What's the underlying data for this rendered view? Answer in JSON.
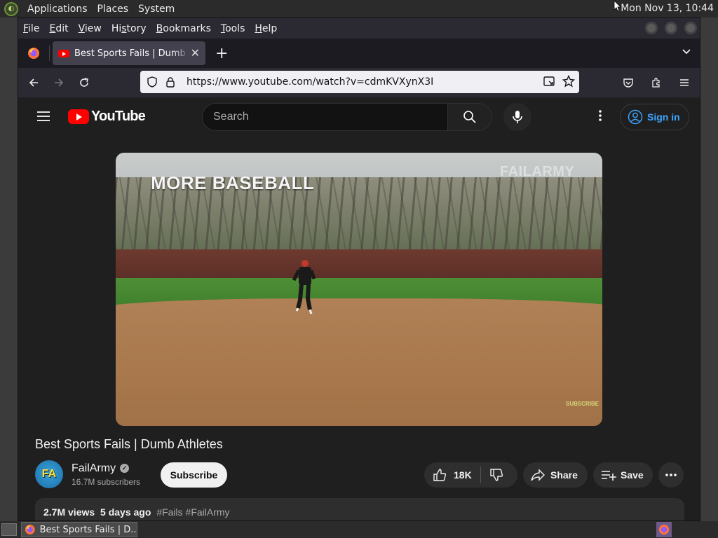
{
  "panel": {
    "menus": [
      "Applications",
      "Places",
      "System"
    ],
    "clock": "Mon Nov 13, 10:44"
  },
  "firefox": {
    "menus": [
      {
        "pre": "",
        "u": "F",
        "post": "ile"
      },
      {
        "pre": "",
        "u": "E",
        "post": "dit"
      },
      {
        "pre": "",
        "u": "V",
        "post": "iew"
      },
      {
        "pre": "Hi",
        "u": "s",
        "post": "tory"
      },
      {
        "pre": "",
        "u": "B",
        "post": "ookmarks"
      },
      {
        "pre": "",
        "u": "T",
        "post": "ools"
      },
      {
        "pre": "",
        "u": "H",
        "post": "elp"
      }
    ],
    "tab_title": "Best Sports Fails | Dumb Athletes",
    "url": "https://www.youtube.com/watch?v=cdmKVXynX3I"
  },
  "youtube": {
    "logo_text": "YouTube",
    "search_placeholder": "Search",
    "signin_label": "Sign in",
    "video_overlay_text": "MORE BASEBALL",
    "video_watermark": "FAILARMY",
    "video_subscribe_text": "SUBSCRIBE",
    "video_title": "Best Sports Fails | Dumb Athletes",
    "channel": {
      "avatar_text": "FA",
      "name": "FailArmy",
      "subscribers": "16.7M subscribers"
    },
    "subscribe_label": "Subscribe",
    "like_count": "18K",
    "share_label": "Share",
    "save_label": "Save",
    "description": {
      "views": "2.7M views",
      "age": "5 days ago",
      "tags": "#Fails #FailArmy"
    }
  },
  "taskbar": {
    "task_title": "Best Sports Fails | D..."
  },
  "colors": {
    "yt_red": "#ff0000",
    "signin_blue": "#3ea6ff",
    "page_bg": "#1f1f1f"
  }
}
